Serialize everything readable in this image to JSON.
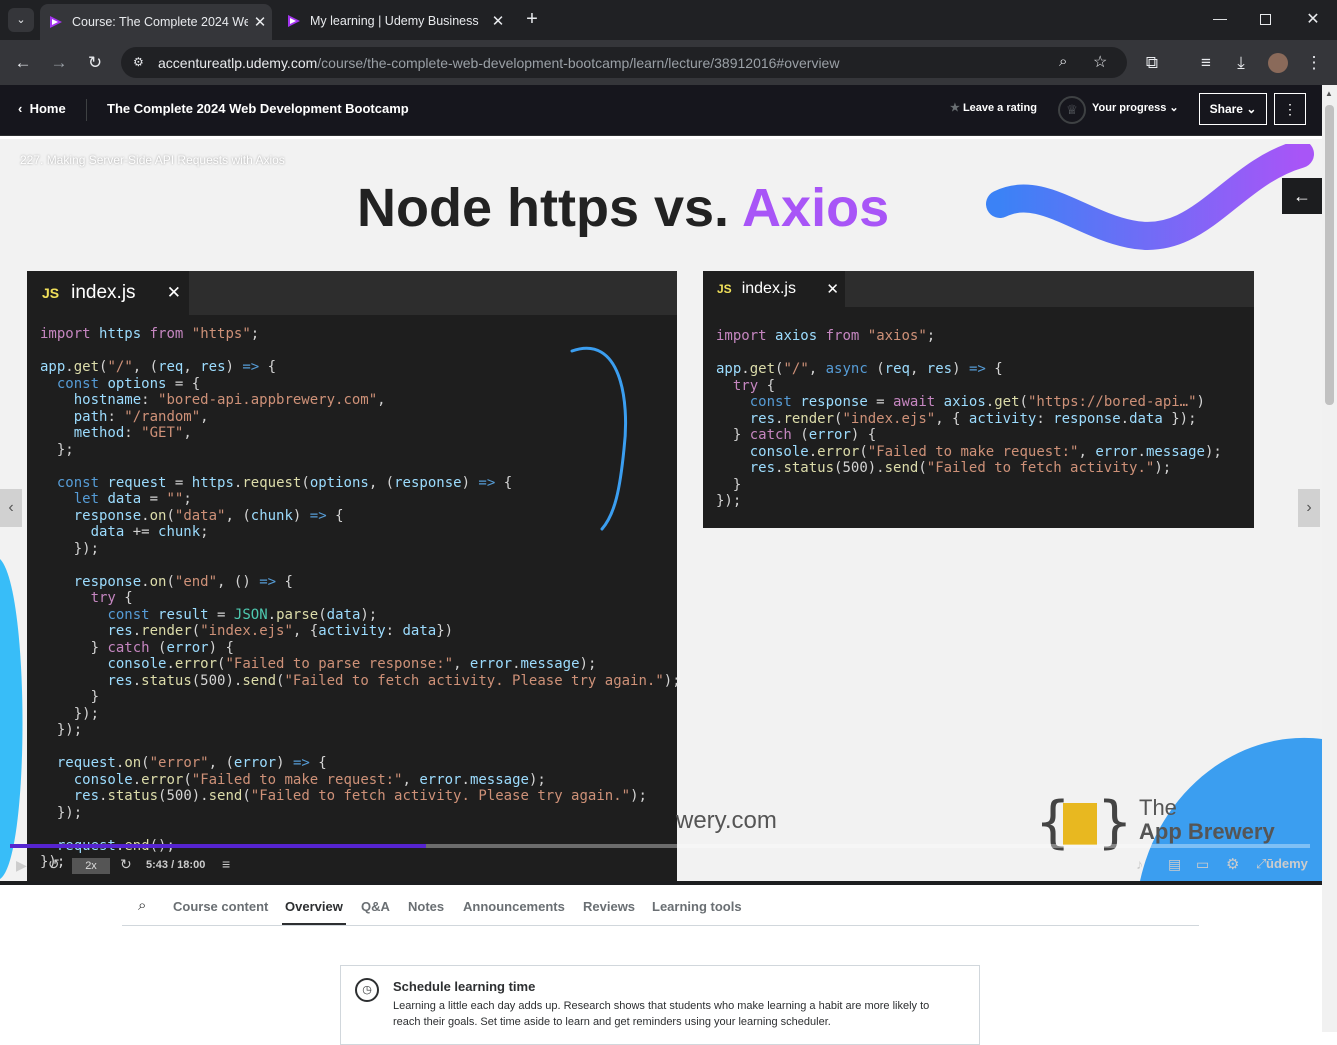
{
  "browser": {
    "tabs": [
      {
        "title": "Course: The Complete 2024 We",
        "active": true
      },
      {
        "title": "My learning | Udemy Business",
        "active": false
      }
    ],
    "url_host": "accentureatlp.udemy.com",
    "url_path": "/course/the-complete-web-development-bootcamp/learn/lecture/38912016#overview"
  },
  "header": {
    "home_label": "Home",
    "course_title": "The Complete 2024 Web Development Bootcamp",
    "rating_label": "Leave a rating",
    "progress_label": "Your progress",
    "share_label": "Share"
  },
  "video": {
    "lecture_title": "227. Making Server-Side API Requests with Axios",
    "slide_title_a": "Node https vs. ",
    "slide_title_b": "Axios",
    "left_file": "index.js",
    "right_file": "index.js",
    "js_badge": "JS",
    "watermark": "wery.com",
    "brand_line1": "The",
    "brand_line2": "App Brewery",
    "speed": "2x",
    "time": "5:43 / 18:00",
    "progress_fraction": 0.32,
    "udemy_mark": "ūdemy"
  },
  "tabs": [
    "Course content",
    "Overview",
    "Q&A",
    "Notes",
    "Announcements",
    "Reviews",
    "Learning tools"
  ],
  "active_tab": "Overview",
  "schedule": {
    "title": "Schedule learning time",
    "text": "Learning a little each day adds up. Research shows that students who make learning a habit are more likely to reach their goals. Set time aside to learn and get reminders using your learning scheduler."
  },
  "colors": {
    "accent_purple": "#a855f7",
    "udemy_purple": "#5624d0",
    "dark_header": "#16161d"
  }
}
